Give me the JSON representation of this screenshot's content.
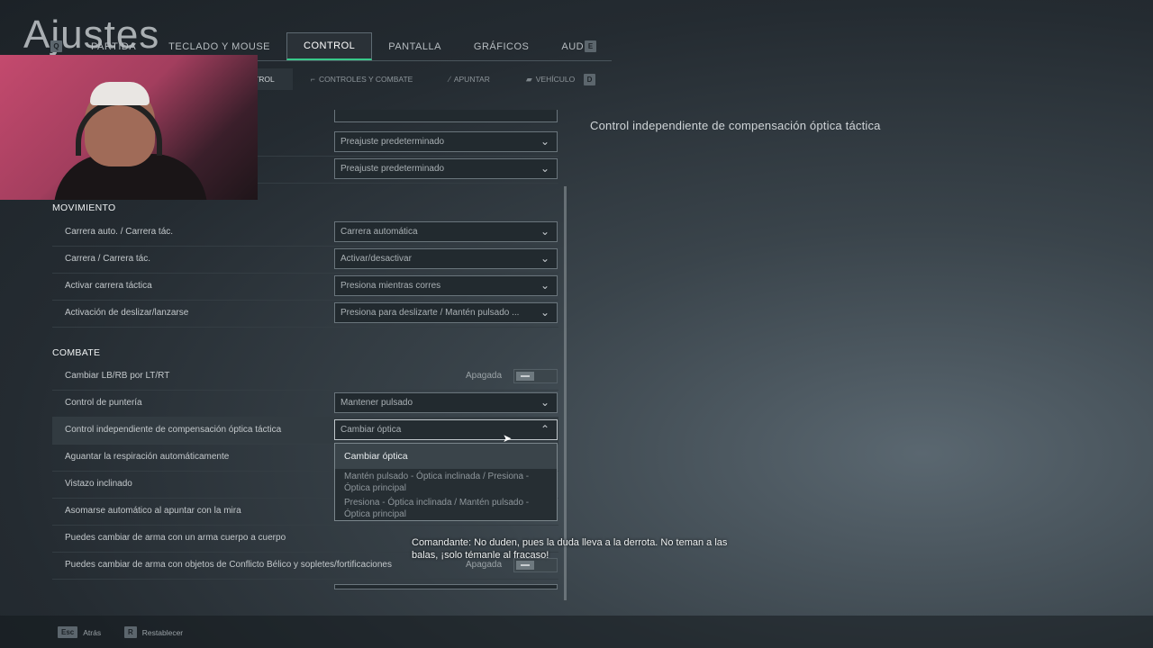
{
  "page_title": "Ajustes",
  "top_tabs": {
    "prev_key": "Q",
    "next_key": "E",
    "items": [
      {
        "label": "PARTIDA"
      },
      {
        "label": "TECLADO Y MOUSE"
      },
      {
        "label": "CONTROL"
      },
      {
        "label": "PANTALLA"
      },
      {
        "label": "GRÁFICOS"
      },
      {
        "label": "AUDIO"
      }
    ],
    "active": "CONTROL"
  },
  "sub_tabs": {
    "items": [
      {
        "label": "TROL"
      },
      {
        "label": "CONTROLES Y COMBATE"
      },
      {
        "label": "APUNTAR"
      },
      {
        "label": "VEHÍCULO"
      }
    ],
    "next_key": "D"
  },
  "settings": {
    "top_rows": [
      {
        "value": "Preajuste predeterminado"
      },
      {
        "value": "Preajuste predeterminado"
      }
    ],
    "movement": {
      "header": "MOVIMIENTO",
      "rows": [
        {
          "label": "Carrera auto. / Carrera tác.",
          "value": "Carrera automática"
        },
        {
          "label": "Carrera / Carrera tác.",
          "value": "Activar/desactivar"
        },
        {
          "label": "Activar carrera táctica",
          "value": "Presiona mientras corres"
        },
        {
          "label": "Activación de deslizar/lanzarse",
          "value": "Presiona para deslizarte / Mantén pulsado ..."
        }
      ]
    },
    "combat": {
      "header": "COMBATE",
      "rows": [
        {
          "label": "Cambiar LB/RB por LT/RT",
          "toggle_label": "Apagada"
        },
        {
          "label": "Control de puntería",
          "value": "Mantener pulsado"
        },
        {
          "label": "Control independiente de compensación óptica táctica",
          "value": "Cambiar óptica"
        },
        {
          "label": "Aguantar la respiración automáticamente"
        },
        {
          "label": "Vistazo inclinado"
        },
        {
          "label": "Asomarse automático al apuntar con la mira"
        },
        {
          "label": "Puedes cambiar de arma con un arma cuerpo a cuerpo"
        },
        {
          "label": "Puedes cambiar de arma con objetos de Conflicto Bélico y sopletes/fortificaciones",
          "toggle_label": "Apagada"
        }
      ]
    }
  },
  "dropdown_menu": {
    "options": [
      {
        "label": "Cambiar óptica",
        "selected": true
      },
      {
        "label": "Mantén pulsado - Óptica inclinada / Presiona - Óptica principal"
      },
      {
        "label": "Presiona - Óptica inclinada / Mantén pulsado - Óptica principal"
      }
    ]
  },
  "description": "Control independiente de compensación óptica táctica",
  "subtitle": {
    "speaker": "Comandante:",
    "text": "No duden, pues la duda lleva a la derrota. No teman a las balas, ¡solo témanle al fracaso!"
  },
  "footer": {
    "back_key": "Esc",
    "back_label": "Atrás",
    "reset_key": "R",
    "reset_label": "Restablecer"
  },
  "colors": {
    "accent": "#38c98a",
    "background": "#242b31"
  }
}
